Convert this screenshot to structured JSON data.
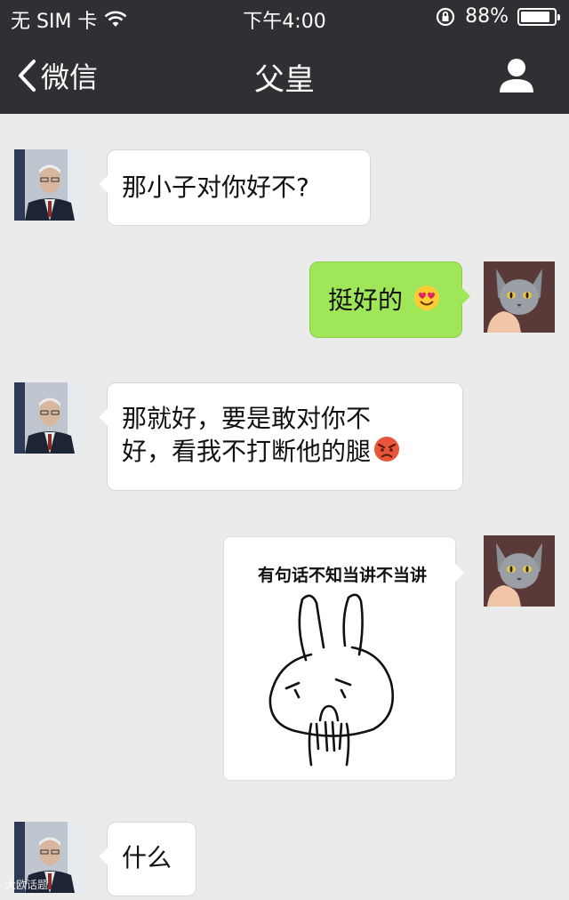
{
  "status_bar": {
    "carrier": "无 SIM 卡",
    "time": "下午4:00",
    "battery_percent": "88%",
    "battery_level": 0.88
  },
  "nav": {
    "back_label": "微信",
    "title": "父皇"
  },
  "messages": [
    {
      "sender": "父皇",
      "direction": "incoming",
      "text": "那小子对你好不?"
    },
    {
      "sender": "me",
      "direction": "outgoing",
      "text": "挺好的",
      "emoji": "smiling-face-with-heart-eyes"
    },
    {
      "sender": "父皇",
      "direction": "incoming",
      "line1": "那就好，要是敢对你不",
      "line2": "好，看我不打断他的腿",
      "emoji": "angry-face"
    },
    {
      "sender": "me",
      "direction": "outgoing",
      "type": "sticker",
      "caption": "有句话不知当讲不当讲"
    },
    {
      "sender": "父皇",
      "direction": "incoming",
      "text": "什么"
    }
  ],
  "watermark": "大欧话题",
  "colors": {
    "bar": "#2e3033",
    "background": "#ebebeb",
    "outgoing_bubble": "#9fe658",
    "incoming_bubble": "#ffffff"
  }
}
